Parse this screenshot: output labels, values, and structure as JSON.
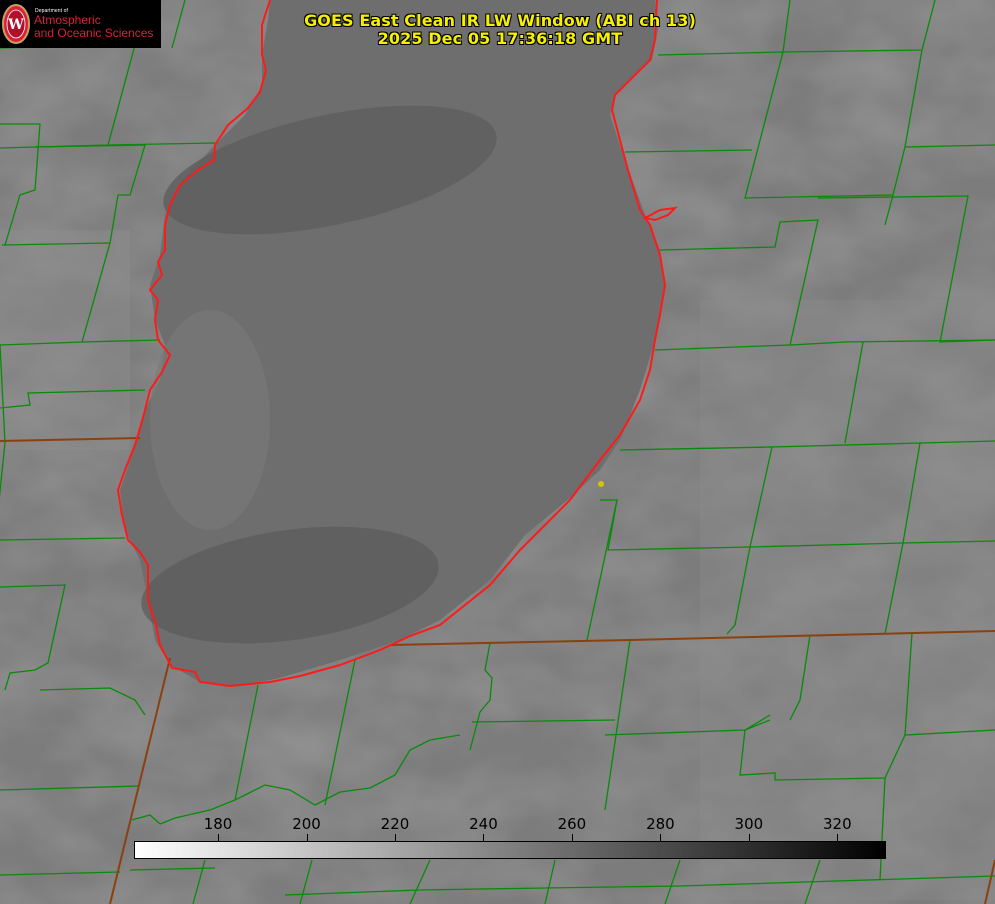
{
  "title": {
    "line1": "GOES East Clean IR LW Window (ABI ch 13)",
    "line2": "2025 Dec 05 17:36:18 GMT"
  },
  "logo": {
    "dept": "Department of",
    "line1": "Atmospheric",
    "line2": "and Oceanic Sciences",
    "seal_letter": "W"
  },
  "colorbar": {
    "ticks": [
      {
        "label": "180",
        "value": 180
      },
      {
        "label": "200",
        "value": 200
      },
      {
        "label": "220",
        "value": 220
      },
      {
        "label": "240",
        "value": 240
      },
      {
        "label": "260",
        "value": 260
      },
      {
        "label": "280",
        "value": 280
      },
      {
        "label": "300",
        "value": 300
      },
      {
        "label": "320",
        "value": 320
      }
    ],
    "range": [
      161,
      331
    ],
    "color_low": "#ffffff",
    "color_high": "#000000"
  },
  "colors": {
    "county_border": "#0a8a0a",
    "state_border": "#8b4010",
    "coastline": "#ff1a1a",
    "title_text": "#f5f000",
    "marker": "#d4c400",
    "logo_red": "#d8203a"
  }
}
